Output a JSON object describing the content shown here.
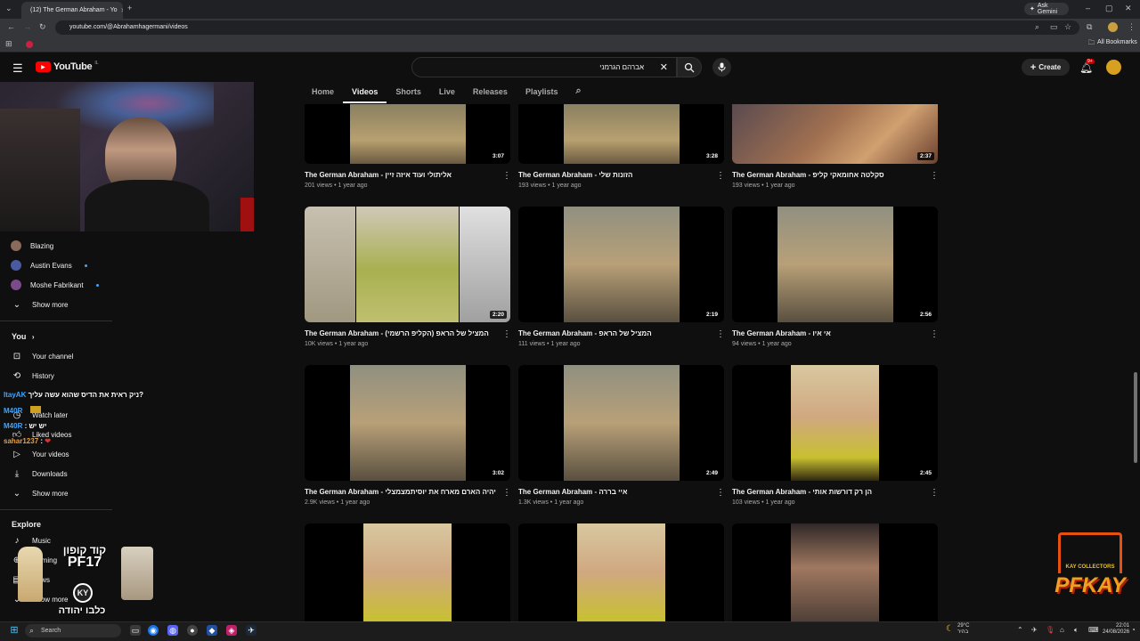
{
  "browser": {
    "tab_title": "(12) The German Abraham - Yo",
    "url": "youtube.com/@Abrahamhagermani/videos",
    "ask_gemini": "Ask Gemini",
    "all_bookmarks": "All Bookmarks"
  },
  "header": {
    "logo": "YouTube",
    "logo_country": "IL",
    "search_value": "אברהם הגרמני",
    "create_label": "Create",
    "notif_badge": "9+"
  },
  "channel_tabs": [
    "Home",
    "Videos",
    "Shorts",
    "Live",
    "Releases",
    "Playlists"
  ],
  "sidebar": {
    "subscriptions": [
      {
        "name": "Blazing",
        "color": "#8a6a5a",
        "live": false
      },
      {
        "name": "Austin Evans",
        "color": "#4a5aa0",
        "live": true
      },
      {
        "name": "Moshe Fabrikant",
        "color": "#7a4a8a",
        "live": true
      }
    ],
    "show_more": "Show more",
    "you_heading": "You",
    "you_items": [
      {
        "label": "Your channel",
        "icon": "person-icon"
      },
      {
        "label": "History",
        "icon": "history-icon"
      },
      {
        "label": "Watch later",
        "icon": "clock-icon"
      },
      {
        "label": "Liked videos",
        "icon": "thumb-up-icon"
      },
      {
        "label": "Your videos",
        "icon": "play-square-icon"
      },
      {
        "label": "Downloads",
        "icon": "download-icon"
      }
    ],
    "show_more_2": "Show more",
    "explore_heading": "Explore",
    "explore_items": [
      {
        "label": "Music",
        "icon": "music-note-icon"
      },
      {
        "label": "Gaming",
        "icon": "gamepad-icon"
      },
      {
        "label": "News",
        "icon": "news-icon"
      }
    ],
    "show_more_3": "Show more"
  },
  "videos": [
    {
      "title": "The German Abraham - אליתולי ועוד איזה זיין",
      "views": "201 views",
      "age": "1 year ago",
      "duration": "3:07"
    },
    {
      "title": "The German Abraham - הזונות שלי",
      "views": "193 views",
      "age": "1 year ago",
      "duration": "3:28"
    },
    {
      "title": "The German Abraham - סקלטה אחומאקי קליפ",
      "views": "193 views",
      "age": "1 year ago",
      "duration": "2:37"
    },
    {
      "title": "The German Abraham - המציל של הראפ (הקליפ הרשמי)",
      "views": "10K views",
      "age": "1 year ago",
      "duration": "2:20"
    },
    {
      "title": "The German Abraham - המציל של הראפ",
      "views": "111 views",
      "age": "1 year ago",
      "duration": "2:19"
    },
    {
      "title": "The German Abraham - אי איו",
      "views": "94 views",
      "age": "1 year ago",
      "duration": "2:56"
    },
    {
      "title": "The German Abraham - שיהיה הארם מארח את יוסיתמצמצלי",
      "views": "2.9K views",
      "age": "1 year ago",
      "duration": "3:02"
    },
    {
      "title": "The German Abraham - איי בררה",
      "views": "1.3K views",
      "age": "1 year ago",
      "duration": "2:49"
    },
    {
      "title": "The German Abraham - הן רק דורשות אותי",
      "views": "103 views",
      "age": "1 year ago",
      "duration": "2:45"
    }
  ],
  "chat": [
    {
      "user": "ItayAK",
      "text": "ניק ראית את הדיס שהוא עשה עליך?",
      "color": "#3ea6ff"
    },
    {
      "user": "M40R",
      "text": "",
      "color": "#3ea6ff"
    },
    {
      "user": "M40R",
      "text": ": יש יש",
      "color": "#3ea6ff"
    },
    {
      "user": "sahar1237",
      "text": ":",
      "color": "#e8a040"
    }
  ],
  "promo": {
    "code_label": "קוד קופון",
    "code": "PF17",
    "brand": "KY",
    "caption": "כלבו יהודה",
    "logo_text": "PFKAY",
    "logo_sub": "KAY COLLECTORS"
  },
  "taskbar": {
    "search": "Search",
    "temp": "29°C",
    "weather": "בהיר",
    "time": "22:01",
    "date": "24/08/2026"
  }
}
